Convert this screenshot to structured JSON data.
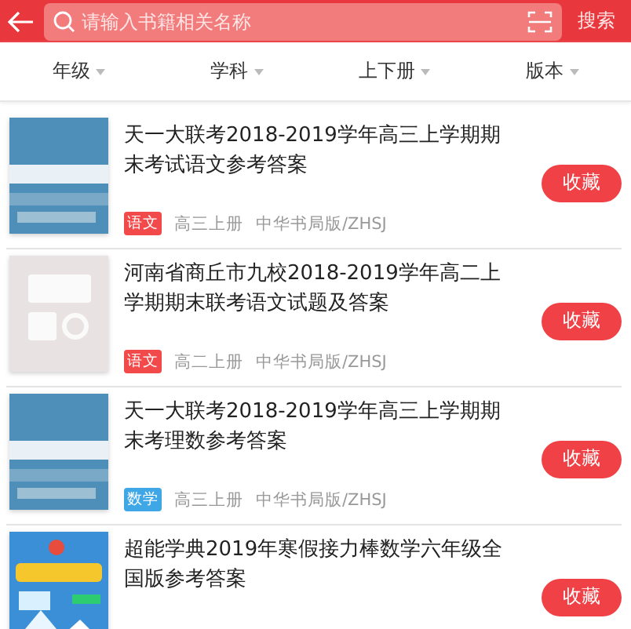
{
  "header": {
    "search": {
      "placeholder": "请输入书籍相关名称"
    },
    "search_button": "搜索"
  },
  "filters": [
    {
      "label": "年级"
    },
    {
      "label": "学科"
    },
    {
      "label": "上下册"
    },
    {
      "label": "版本"
    }
  ],
  "books": [
    {
      "title": "天一大联考2018-2019学年高三上学期期末考试语文参考答案",
      "subject": "语文",
      "color": "#f24a4a",
      "grade": "高三上册",
      "publisher": "中华书局版/ZHSJ",
      "button": "收藏"
    },
    {
      "title": "河南省商丘市九校2018-2019学年高二上学期期末联考语文试题及答案",
      "subject": "语文",
      "color": "#f24a4a",
      "grade": "高二上册",
      "publisher": "中华书局版/ZHSJ",
      "button": "收藏"
    },
    {
      "title": "天一大联考2018-2019学年高三上学期期末考理数参考答案",
      "subject": "数学",
      "color": "#3fa7e6",
      "grade": "高三上册",
      "publisher": "中华书局版/ZHSJ",
      "button": "收藏"
    },
    {
      "title": "超能学典2019年寒假接力棒数学六年级全国版参考答案",
      "button": "收藏"
    }
  ]
}
